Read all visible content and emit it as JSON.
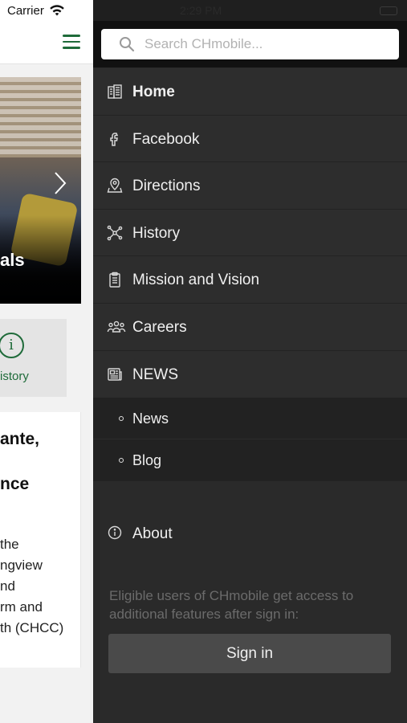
{
  "status": {
    "carrier": "Carrier",
    "time": "2:29 PM"
  },
  "background_app": {
    "hero_caption": "als",
    "history_tile_label": "istory",
    "card_lines": {
      "h1": "ante,",
      "h2": "nce",
      "p": "the\nngview\nnd\nrm and\nth (CHCC)"
    }
  },
  "drawer": {
    "search_placeholder": "Search CHmobile...",
    "menu": [
      {
        "label": "Home",
        "icon": "building-icon",
        "active": true
      },
      {
        "label": "Facebook",
        "icon": "facebook-icon"
      },
      {
        "label": "Directions",
        "icon": "map-pin-icon"
      },
      {
        "label": "History",
        "icon": "network-icon"
      },
      {
        "label": "Mission and Vision",
        "icon": "clipboard-icon"
      },
      {
        "label": "Careers",
        "icon": "people-icon"
      },
      {
        "label": "NEWS",
        "icon": "newspaper-icon"
      }
    ],
    "submenu": [
      {
        "label": "News"
      },
      {
        "label": "Blog"
      }
    ],
    "about_label": "About",
    "signin_note": "Eligible users of CHmobile get access to additional features after sign in:",
    "signin_button": "Sign in"
  },
  "colors": {
    "accent_green": "#1f6b3a",
    "drawer_bg": "#2a2a2a",
    "submenu_bg": "#222222"
  }
}
